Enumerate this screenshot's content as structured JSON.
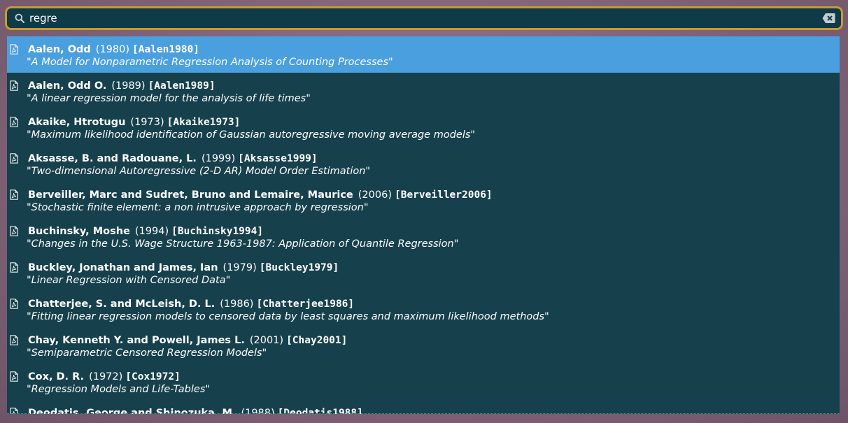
{
  "search": {
    "value": "regre",
    "icon": "search-icon",
    "clear_icon": "clear-icon"
  },
  "colors": {
    "search_border": "#c99a2e",
    "search_bg": "#0f3a48",
    "list_bg": "#16404c",
    "selected_bg": "#4a9fde",
    "text": "#ffffff"
  },
  "results": [
    {
      "authors": "Aalen, Odd",
      "year": "(1980)",
      "key": "[Aalen1980]",
      "title": "\"A Model for Nonparametric Regression Analysis of Counting Processes\"",
      "selected": true
    },
    {
      "authors": "Aalen, Odd O.",
      "year": "(1989)",
      "key": "[Aalen1989]",
      "title": "\"A linear regression model for the analysis of life times\""
    },
    {
      "authors": "Akaike, Htrotugu",
      "year": "(1973)",
      "key": "[Akaike1973]",
      "title": "\"Maximum likelihood identification of Gaussian autoregressive moving average models\""
    },
    {
      "authors": "Aksasse, B. and Radouane, L.",
      "year": "(1999)",
      "key": "[Aksasse1999]",
      "title": "\"Two-dimensional Autoregressive (2-D AR) Model Order Estimation\""
    },
    {
      "authors": "Berveiller, Marc and Sudret, Bruno and Lemaire, Maurice",
      "year": "(2006)",
      "key": "[Berveiller2006]",
      "title": "\"Stochastic finite element: a non intrusive approach by regression\""
    },
    {
      "authors": "Buchinsky, Moshe",
      "year": "(1994)",
      "key": "[Buchinsky1994]",
      "title": "\"Changes in the U.S. Wage Structure 1963-1987: Application of Quantile Regression\""
    },
    {
      "authors": "Buckley, Jonathan and James, Ian",
      "year": "(1979)",
      "key": "[Buckley1979]",
      "title": "\"Linear Regression with Censored Data\""
    },
    {
      "authors": "Chatterjee, S. and McLeish, D. L.",
      "year": "(1986)",
      "key": "[Chatterjee1986]",
      "title": "\"Fitting linear regression models to censored data by least squares and maximum likelihood methods\""
    },
    {
      "authors": "Chay, Kenneth Y. and Powell, James L.",
      "year": "(2001)",
      "key": "[Chay2001]",
      "title": "\"Semiparametric Censored Regression Models\""
    },
    {
      "authors": "Cox, D. R.",
      "year": "(1972)",
      "key": "[Cox1972]",
      "title": "\"Regression Models and Life-Tables\""
    },
    {
      "authors": "Deodatis, George and Shinozuka, M.",
      "year": "(1988)",
      "key": "[Deodatis1988]",
      "title": ""
    }
  ]
}
